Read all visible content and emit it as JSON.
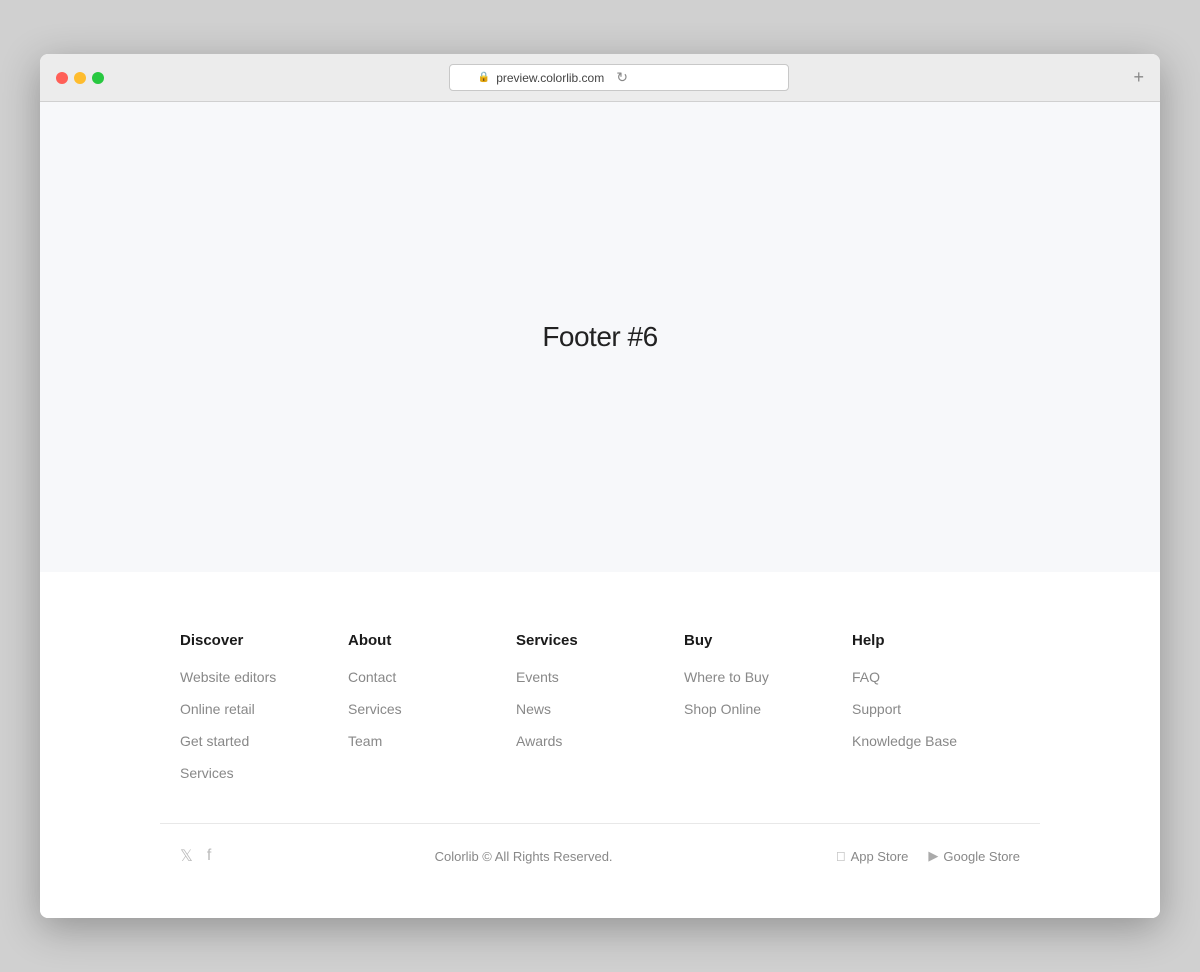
{
  "browser": {
    "url": "preview.colorlib.com",
    "new_tab_label": "+"
  },
  "page": {
    "title": "Footer #6"
  },
  "footer": {
    "columns": [
      {
        "id": "discover",
        "title": "Discover",
        "links": [
          {
            "label": "Website editors",
            "href": "#"
          },
          {
            "label": "Online retail",
            "href": "#"
          },
          {
            "label": "Get started",
            "href": "#"
          },
          {
            "label": "Services",
            "href": "#"
          }
        ]
      },
      {
        "id": "about",
        "title": "About",
        "links": [
          {
            "label": "Contact",
            "href": "#"
          },
          {
            "label": "Services",
            "href": "#"
          },
          {
            "label": "Team",
            "href": "#"
          }
        ]
      },
      {
        "id": "services",
        "title": "Services",
        "links": [
          {
            "label": "Events",
            "href": "#"
          },
          {
            "label": "News",
            "href": "#"
          },
          {
            "label": "Awards",
            "href": "#"
          }
        ]
      },
      {
        "id": "buy",
        "title": "Buy",
        "links": [
          {
            "label": "Where to Buy",
            "href": "#"
          },
          {
            "label": "Shop Online",
            "href": "#"
          }
        ]
      },
      {
        "id": "help",
        "title": "Help",
        "links": [
          {
            "label": "FAQ",
            "href": "#"
          },
          {
            "label": "Support",
            "href": "#"
          },
          {
            "label": "Knowledge Base",
            "href": "#"
          }
        ]
      }
    ],
    "copyright": "Colorlib © All Rights Reserved.",
    "app_store_label": "App Store",
    "google_store_label": "Google Store"
  }
}
